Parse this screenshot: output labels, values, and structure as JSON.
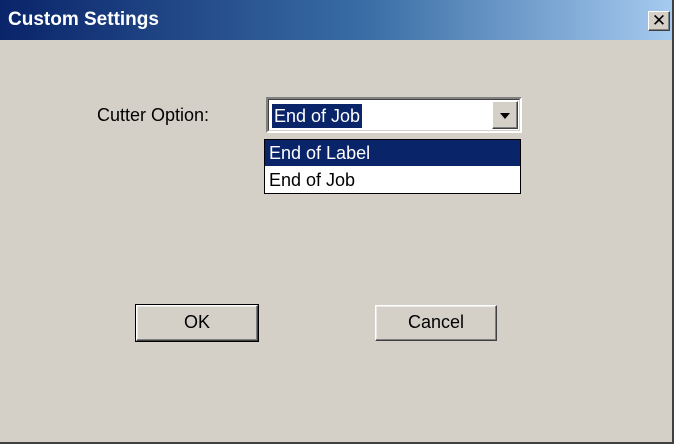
{
  "window": {
    "title": "Custom Settings",
    "close_icon": "close-icon"
  },
  "form": {
    "cutter_label": "Cutter Option:",
    "cutter_value": "End of Job",
    "options": [
      "End of Label",
      "End of Job"
    ],
    "highlighted_option": "End of Label"
  },
  "buttons": {
    "ok": "OK",
    "cancel": "Cancel"
  },
  "colors": {
    "title_gradient_start": "#0a246a",
    "title_gradient_end": "#a6caf0",
    "face": "#d4d0c8",
    "selection": "#0a246a"
  }
}
